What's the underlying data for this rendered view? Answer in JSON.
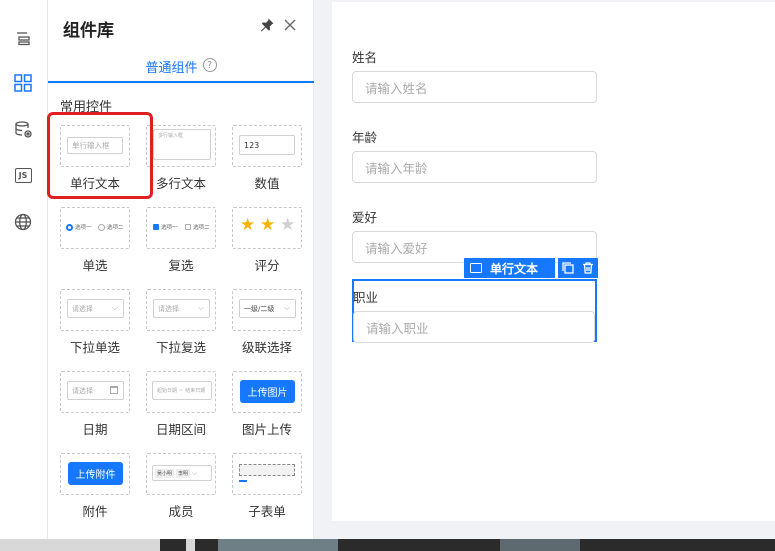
{
  "panel": {
    "title": "组件库",
    "tab_label": "普通组件",
    "tab_help": "?",
    "section_title": "常用控件"
  },
  "rail": {
    "icons": [
      "outline-icon",
      "components-icon",
      "datasource-icon",
      "js-icon",
      "globe-icon"
    ],
    "js_label": "JS"
  },
  "components": [
    {
      "label": "单行文本",
      "preview": "单行输入框"
    },
    {
      "label": "多行文本",
      "preview": "多行输入框"
    },
    {
      "label": "数值",
      "preview": "123"
    },
    {
      "label": "单选",
      "preview": [
        "选项一",
        "选项二"
      ]
    },
    {
      "label": "复选",
      "preview": [
        "选项一",
        "选项二"
      ]
    },
    {
      "label": "评分",
      "rating": {
        "filled": 2,
        "total": 3
      }
    },
    {
      "label": "下拉单选",
      "preview": "请选择"
    },
    {
      "label": "下拉复选",
      "preview": "请选择"
    },
    {
      "label": "级联选择",
      "preview": "一级/二级"
    },
    {
      "label": "日期",
      "preview": "请选择"
    },
    {
      "label": "日期区间",
      "preview": [
        "起始日期",
        "结束日期"
      ]
    },
    {
      "label": "图片上传",
      "preview": "上传图片"
    },
    {
      "label": "附件",
      "preview": "上传附件"
    },
    {
      "label": "成员",
      "preview": [
        "吴小明",
        "李明"
      ]
    },
    {
      "label": "子表单"
    }
  ],
  "form": {
    "fields": [
      {
        "label": "姓名",
        "placeholder": "请输入姓名"
      },
      {
        "label": "年龄",
        "placeholder": "请输入年龄"
      },
      {
        "label": "爱好",
        "placeholder": "请输入爱好"
      },
      {
        "label": "职业",
        "placeholder": "请输入职业"
      }
    ],
    "selected_tag": "单行文本"
  },
  "colors": {
    "accent": "#1677ff",
    "highlight": "#e02020"
  }
}
